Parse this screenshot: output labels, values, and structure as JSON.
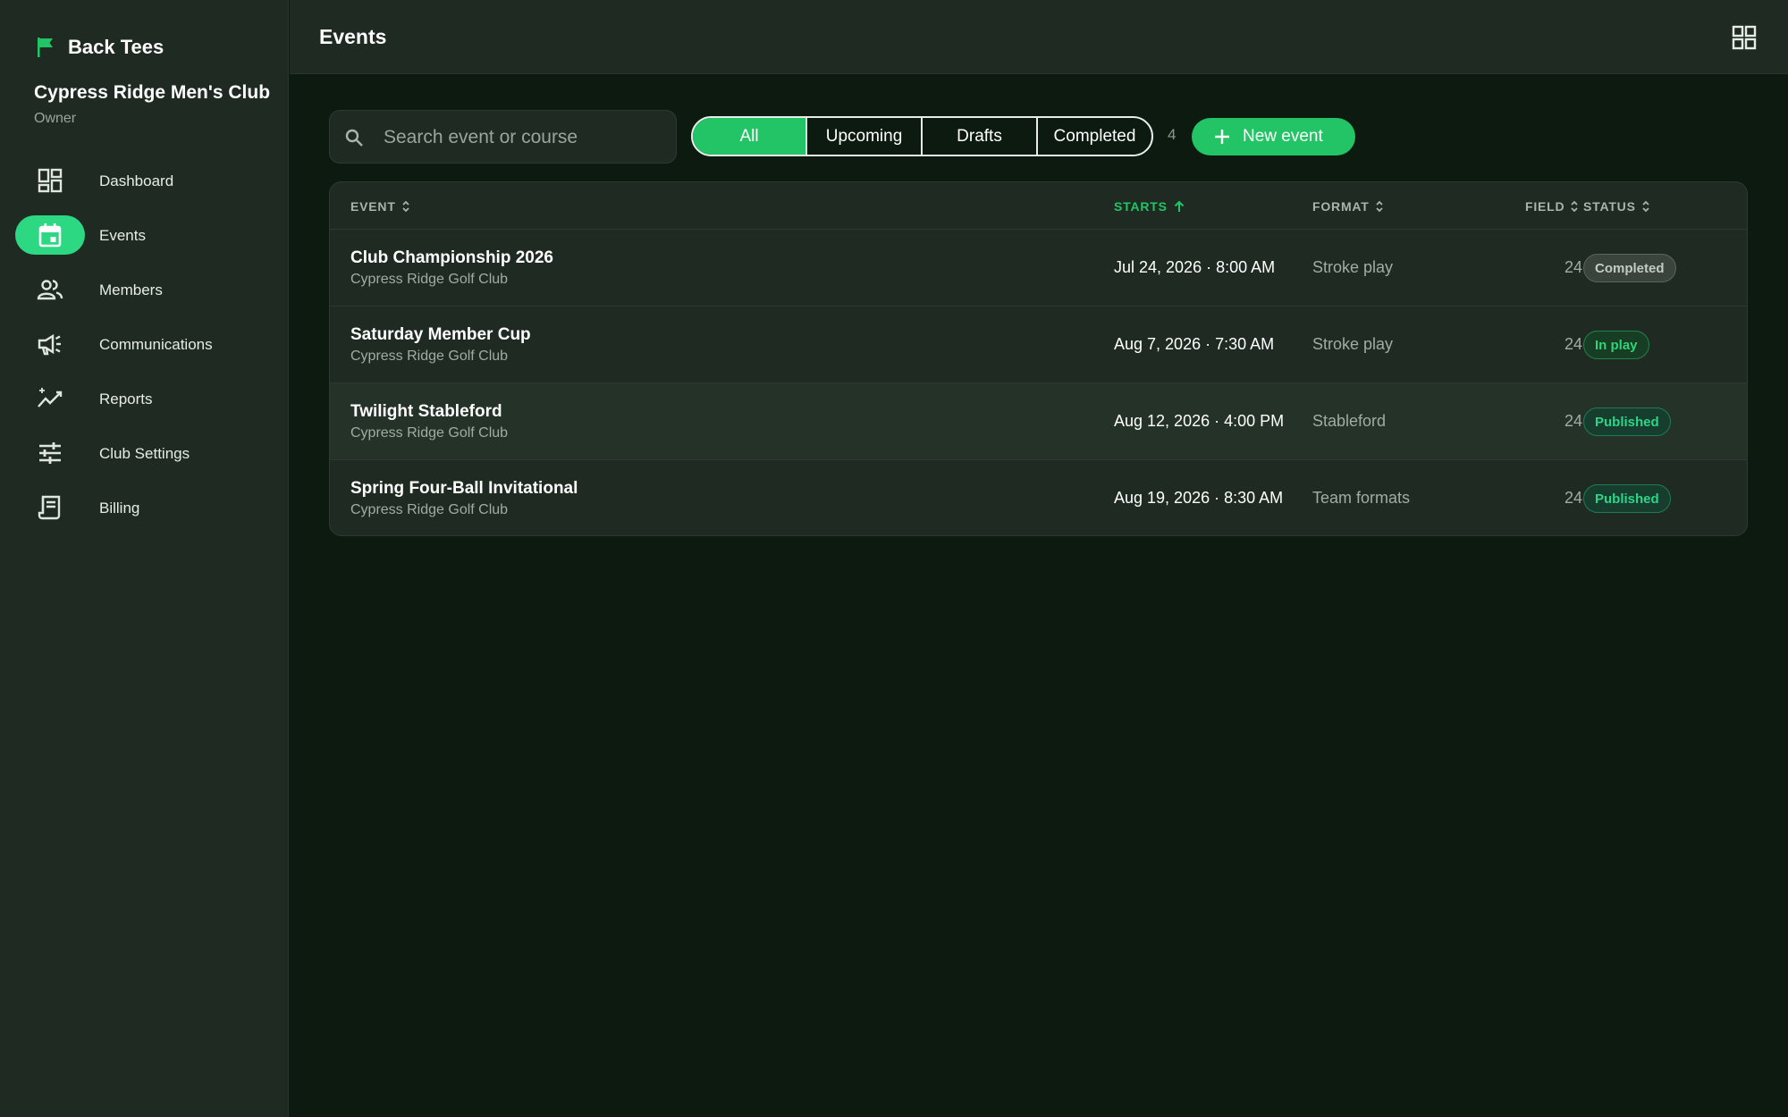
{
  "app": {
    "name": "Back Tees",
    "club_name": "Cypress Ridge Men's Club",
    "role": "Owner"
  },
  "nav": [
    {
      "label": "Dashboard",
      "icon": "dashboard-icon"
    },
    {
      "label": "Events",
      "icon": "calendar-icon",
      "active": true
    },
    {
      "label": "Members",
      "icon": "people-icon"
    },
    {
      "label": "Communications",
      "icon": "megaphone-icon"
    },
    {
      "label": "Reports",
      "icon": "trend-icon"
    },
    {
      "label": "Club Settings",
      "icon": "sliders-icon"
    },
    {
      "label": "Billing",
      "icon": "receipt-icon"
    }
  ],
  "header": {
    "title": "Events",
    "grid_icon": "grid-view-icon"
  },
  "toolbar": {
    "search_placeholder": "Search event or course",
    "filters": [
      "All",
      "Upcoming",
      "Drafts",
      "Completed"
    ],
    "active_filter": "All",
    "count": "4",
    "new_button": "New event"
  },
  "table": {
    "columns": {
      "event": "EVENT",
      "starts": "STARTS",
      "format": "FORMAT",
      "field": "FIELD",
      "status": "STATUS"
    },
    "sorted_column": "starts",
    "rows": [
      {
        "name": "Club Championship 2026",
        "course": "Cypress Ridge Golf Club",
        "starts": "Jul 24, 2026 · 8:00 AM",
        "format": "Stroke play",
        "field": "24",
        "status": "Completed"
      },
      {
        "name": "Saturday Member Cup",
        "course": "Cypress Ridge Golf Club",
        "starts": "Aug 7, 2026 · 7:30 AM",
        "format": "Stroke play",
        "field": "24",
        "status": "In play"
      },
      {
        "name": "Twilight Stableford",
        "course": "Cypress Ridge Golf Club",
        "starts": "Aug 12, 2026 · 4:00 PM",
        "format": "Stableford",
        "field": "24",
        "status": "Published"
      },
      {
        "name": "Spring Four-Ball Invitational",
        "course": "Cypress Ridge Golf Club",
        "starts": "Aug 19, 2026 · 8:30 AM",
        "format": "Team formats",
        "field": "24",
        "status": "Published"
      }
    ]
  },
  "colors": {
    "accent": "#23c465",
    "background": "#0d1a10",
    "panel": "#1f2b22"
  }
}
